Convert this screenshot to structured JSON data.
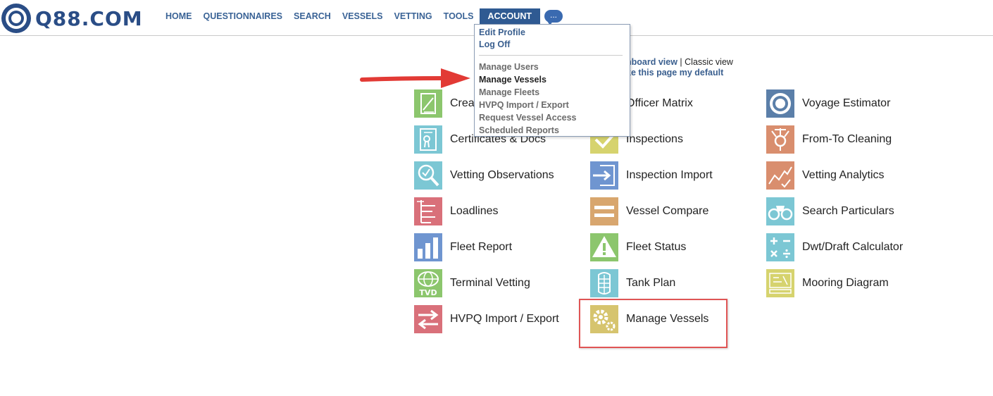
{
  "brand": {
    "name": "Q88.COM"
  },
  "nav": {
    "items": [
      "HOME",
      "QUESTIONNAIRES",
      "SEARCH",
      "VESSELS",
      "VETTING",
      "TOOLS"
    ],
    "active": "ACCOUNT",
    "more": "..."
  },
  "dropdown": {
    "items": [
      {
        "label": "Edit Profile"
      },
      {
        "label": "Log Off"
      },
      {
        "label": "Manage Users"
      },
      {
        "label": "Manage Vessels"
      },
      {
        "label": "Manage Fleets"
      },
      {
        "label": "HVPQ Import / Export"
      },
      {
        "label": "Request Vessel Access"
      },
      {
        "label": "Scheduled Reports"
      }
    ]
  },
  "view_links": {
    "dashboard": "hboard view",
    "separator": "|",
    "classic": "Classic view",
    "default": "ke this page my default"
  },
  "tiles": {
    "col1": [
      {
        "label": "Crea",
        "icon": "create-doc-icon",
        "color": "#8cc66d"
      },
      {
        "label": "Certificates & Docs",
        "icon": "certificate-icon",
        "color": "#7cc7d4"
      },
      {
        "label": "Vetting Observations",
        "icon": "magnify-check-icon",
        "color": "#7cc7d4"
      },
      {
        "label": "Loadlines",
        "icon": "loadline-icon",
        "color": "#d9707a"
      },
      {
        "label": "Fleet Report",
        "icon": "bar-chart-icon",
        "color": "#6f95d0"
      },
      {
        "label": "Terminal Vetting",
        "icon": "tvd-globe-icon",
        "color": "#8cc66d"
      },
      {
        "label": "HVPQ Import / Export",
        "icon": "swap-arrows-icon",
        "color": "#d9707a"
      }
    ],
    "col2": [
      {
        "label": "Officer Matrix",
        "icon": "officer-matrix-icon",
        "color": "#d9707a"
      },
      {
        "label": "Inspections",
        "icon": "check-icon",
        "color": "#d6d36e"
      },
      {
        "label": "Inspection Import",
        "icon": "import-arrow-icon",
        "color": "#6f95d0"
      },
      {
        "label": "Vessel Compare",
        "icon": "equals-icon",
        "color": "#d8a66e"
      },
      {
        "label": "Fleet Status",
        "icon": "warning-icon",
        "color": "#8cc66d"
      },
      {
        "label": "Tank Plan",
        "icon": "tank-icon",
        "color": "#7cc7d4"
      },
      {
        "label": "Manage Vessels",
        "icon": "gears-icon",
        "color": "#d6c46e"
      }
    ],
    "col3": [
      {
        "label": "Voyage Estimator",
        "icon": "lifebuoy-icon",
        "color": "#5b7fa9"
      },
      {
        "label": "From-To Cleaning",
        "icon": "valve-icon",
        "color": "#d98e6e"
      },
      {
        "label": "Vetting Analytics",
        "icon": "trend-line-icon",
        "color": "#d98e6e"
      },
      {
        "label": "Search Particulars",
        "icon": "binoculars-icon",
        "color": "#7cc7d4"
      },
      {
        "label": "Dwt/Draft Calculator",
        "icon": "calculator-icon",
        "color": "#7cc7d4"
      },
      {
        "label": "Mooring Diagram",
        "icon": "mooring-diagram-icon",
        "color": "#d6d36e"
      }
    ]
  }
}
